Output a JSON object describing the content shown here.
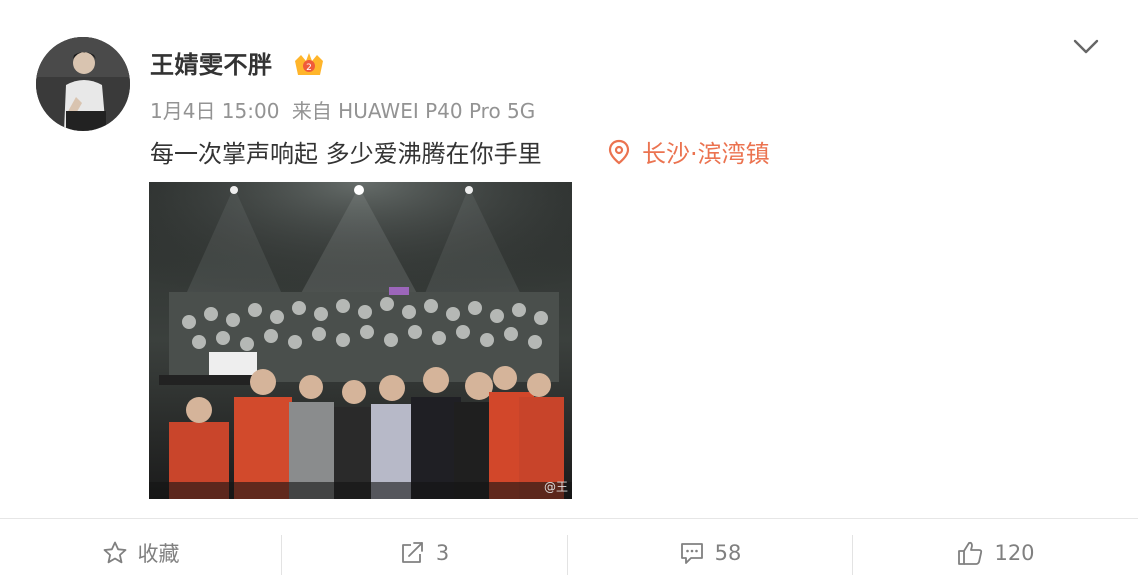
{
  "post": {
    "username": "王婧雯不胖",
    "time": "1月4日 15:00",
    "source": "来自 HUAWEI P40 Pro 5G",
    "text": "每一次掌声响起 多少爱沸腾在你手里",
    "location": "长沙·滨湾镇",
    "photo_watermark": "@王"
  },
  "actions": {
    "favorite_label": "收藏",
    "repost_count": "3",
    "comment_count": "58",
    "like_count": "120"
  },
  "icons": {
    "vip": "crown-badge-icon",
    "location": "location-pin-icon",
    "more": "chevron-down-icon",
    "favorite": "star-icon",
    "repost": "repost-icon",
    "comment": "comment-icon",
    "like": "thumbs-up-icon"
  },
  "colors": {
    "location": "#eb7350",
    "meta": "#939393",
    "text": "#333333",
    "action": "#808080"
  }
}
